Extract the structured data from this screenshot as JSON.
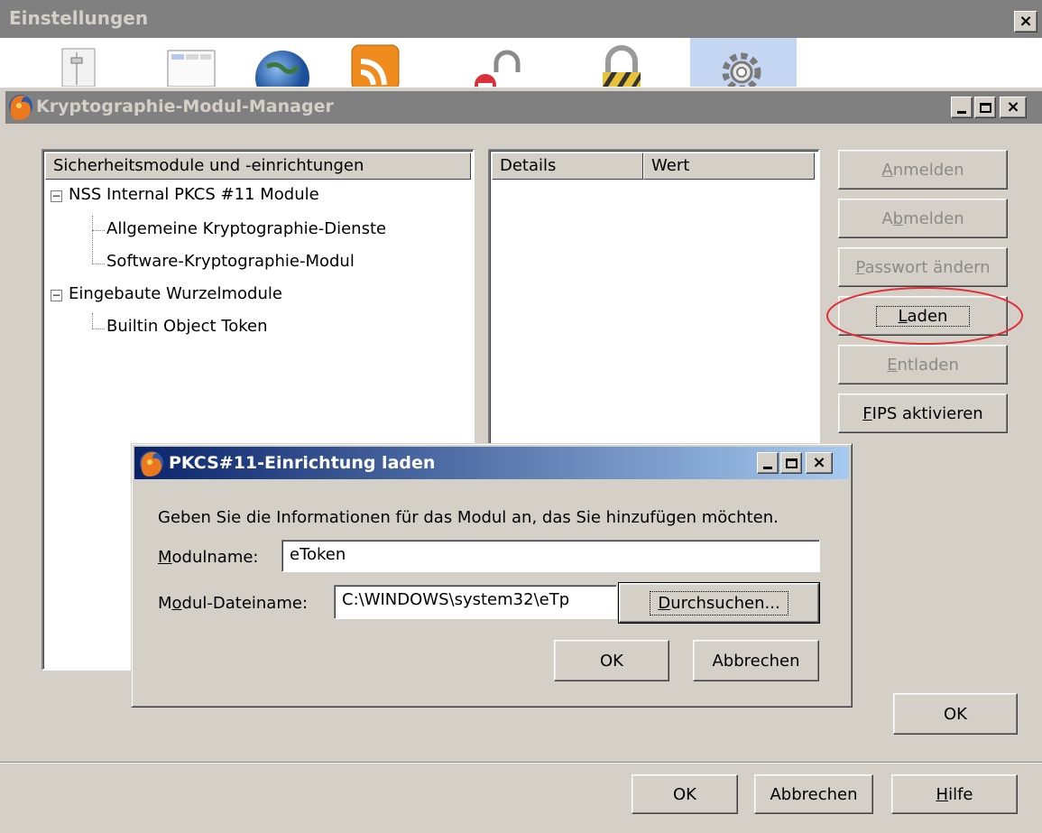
{
  "prefs": {
    "title": "Einstellungen",
    "close": "×",
    "toolbar_icons": [
      "main-icon",
      "tabs-icon",
      "content-icon",
      "feeds-icon",
      "privacy-icon",
      "security-icon",
      "advanced-icon"
    ],
    "buttons": {
      "ok": "OK",
      "cancel": "Abbrechen",
      "help_pre": "",
      "help_key": "H",
      "help_post": "ilfe"
    }
  },
  "devmgr": {
    "title": "Kryptographie-Modul-Manager",
    "tree_header": "Sicherheitsmodule und -einrichtungen",
    "tree": [
      {
        "label": "NSS Internal PKCS #11 Module",
        "expander": "−"
      },
      {
        "label": "Allgemeine Kryptographie-Dienste"
      },
      {
        "label": "Software-Kryptographie-Modul"
      },
      {
        "label": "Eingebaute Wurzelmodule",
        "expander": "−"
      },
      {
        "label": "Builtin Object Token"
      }
    ],
    "details_headers": {
      "details": "Details",
      "value": "Wert"
    },
    "buttons": {
      "login": {
        "pre": "",
        "key": "A",
        "post": "nmelden"
      },
      "logout": {
        "pre": "A",
        "key": "b",
        "post": "melden"
      },
      "change_pw": {
        "pre": "",
        "key": "P",
        "post": "asswort ändern"
      },
      "load": {
        "pre": "",
        "key": "L",
        "post": "aden"
      },
      "unload": {
        "pre": "",
        "key": "E",
        "post": "ntladen"
      },
      "fips": {
        "pre": "",
        "key": "F",
        "post": "IPS aktivieren"
      },
      "ok": "OK"
    },
    "highlight_color": "#e0303a"
  },
  "load_dialog": {
    "title": "PKCS#11-Einrichtung laden",
    "instruction": "Geben Sie die Informationen für das Modul an, das Sie hinzufügen möchten.",
    "module_name_label": {
      "pre": "",
      "key": "M",
      "post": "odulname:"
    },
    "module_name_value": "eToken",
    "module_file_label": {
      "pre": "M",
      "key": "o",
      "post": "dul-Dateiname:"
    },
    "module_file_value": "C:\\WINDOWS\\system32\\eTp",
    "browse": {
      "pre": "",
      "key": "D",
      "post": "urchsuchen..."
    },
    "ok": "OK",
    "cancel": "Abbrechen",
    "title_gradient": [
      "#0a246a",
      "#a6caf0"
    ]
  }
}
